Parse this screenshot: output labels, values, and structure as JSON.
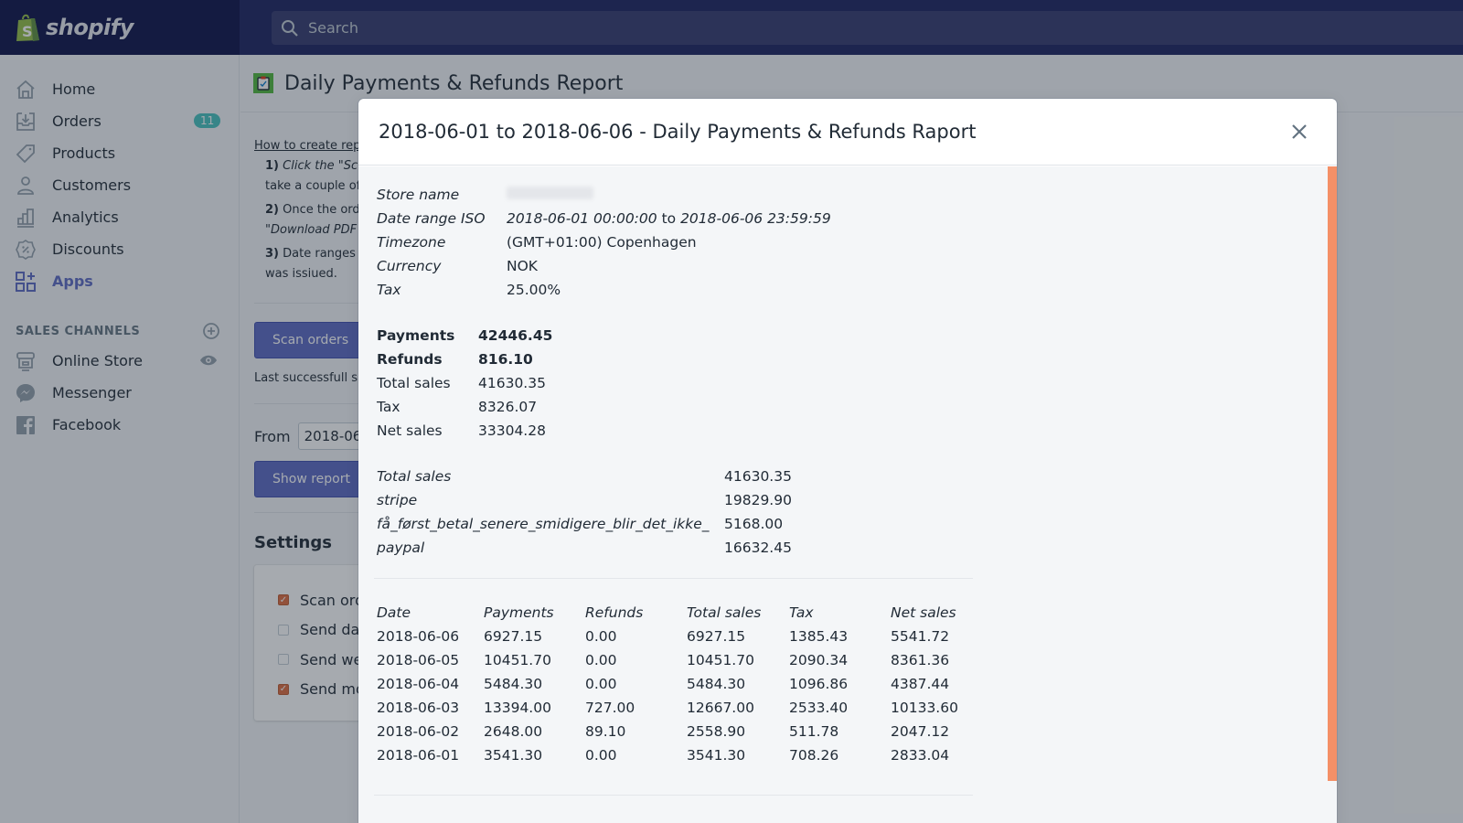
{
  "topbar": {
    "logo_text": "shopify",
    "search_placeholder": "Search"
  },
  "sidebar": {
    "items": [
      {
        "label": "Home",
        "icon": "home-icon"
      },
      {
        "label": "Orders",
        "icon": "orders-icon",
        "badge": "11"
      },
      {
        "label": "Products",
        "icon": "tag-icon"
      },
      {
        "label": "Customers",
        "icon": "person-icon"
      },
      {
        "label": "Analytics",
        "icon": "bar-chart-icon"
      },
      {
        "label": "Discounts",
        "icon": "discount-icon"
      },
      {
        "label": "Apps",
        "icon": "apps-icon",
        "active": true
      }
    ],
    "sales_channels_title": "SALES CHANNELS",
    "channels": [
      {
        "label": "Online Store",
        "icon": "store-icon"
      },
      {
        "label": "Messenger",
        "icon": "messenger-icon"
      },
      {
        "label": "Facebook",
        "icon": "facebook-icon"
      }
    ]
  },
  "page": {
    "title": "Daily Payments & Refunds Report",
    "howto_link": "How to create rep",
    "steps": [
      {
        "num": "1)",
        "line1": "Click the \"Sc",
        "line2": "take a couple of"
      },
      {
        "num": "2)",
        "line1": "Once the ord",
        "line2": "\"Download PDF"
      },
      {
        "num": "3)",
        "line1": "Date ranges",
        "line2": "was issiued."
      }
    ],
    "scan_button": "Scan orders",
    "last_scan_text": "Last successfull s",
    "from_label": "From",
    "from_value": "2018-06-",
    "show_report_button": "Show report",
    "settings_title": "Settings",
    "settings": [
      {
        "label": "Scan ord",
        "checked": true
      },
      {
        "label": "Send da",
        "checked": false
      },
      {
        "label": "Send we",
        "checked": false
      },
      {
        "label": "Send mo",
        "checked": true
      }
    ]
  },
  "modal": {
    "title": "2018-06-01 to 2018-06-06 - Daily Payments & Refunds Raport",
    "meta": {
      "store_name_label": "Store name",
      "date_range_label": "Date range ISO",
      "date_from": "2018-06-01 00:00:00",
      "date_to_word": "to",
      "date_to": "2018-06-06 23:59:59",
      "timezone_label": "Timezone",
      "timezone": "(GMT+01:00) Copenhagen",
      "currency_label": "Currency",
      "currency": "NOK",
      "tax_label": "Tax",
      "tax": "25.00%"
    },
    "summary": [
      {
        "label": "Payments",
        "value": "42446.45"
      },
      {
        "label": "Refunds",
        "value": "816.10"
      },
      {
        "label": "Total sales",
        "value": "41630.35"
      },
      {
        "label": "Tax",
        "value": "8326.07"
      },
      {
        "label": "Net sales",
        "value": "33304.28"
      }
    ],
    "gateways": [
      {
        "label": "Total sales",
        "value": "41630.35"
      },
      {
        "label": "stripe",
        "value": "19829.90"
      },
      {
        "label": "få_først_betal_senere_smidigere_blir_det_ikke_",
        "value": "5168.00"
      },
      {
        "label": "paypal",
        "value": "16632.45"
      }
    ],
    "daily": {
      "headers": [
        "Date",
        "Payments",
        "Refunds",
        "Total sales",
        "Tax",
        "Net sales"
      ],
      "rows": [
        [
          "2018-06-06",
          "6927.15",
          "0.00",
          "6927.15",
          "1385.43",
          "5541.72"
        ],
        [
          "2018-06-05",
          "10451.70",
          "0.00",
          "10451.70",
          "2090.34",
          "8361.36"
        ],
        [
          "2018-06-04",
          "5484.30",
          "0.00",
          "5484.30",
          "1096.86",
          "4387.44"
        ],
        [
          "2018-06-03",
          "13394.00",
          "727.00",
          "12667.00",
          "2533.40",
          "10133.60"
        ],
        [
          "2018-06-02",
          "2648.00",
          "89.10",
          "2558.90",
          "511.78",
          "2047.12"
        ],
        [
          "2018-06-01",
          "3541.30",
          "0.00",
          "3541.30",
          "708.26",
          "2833.04"
        ]
      ]
    }
  },
  "colors": {
    "topbar": "#1c2260",
    "logo_area": "#0c1248",
    "accent": "#5c6ac4",
    "badge": "#47c1bf",
    "scrollbar": "#f49067",
    "checkbox": "#de6c3f"
  }
}
